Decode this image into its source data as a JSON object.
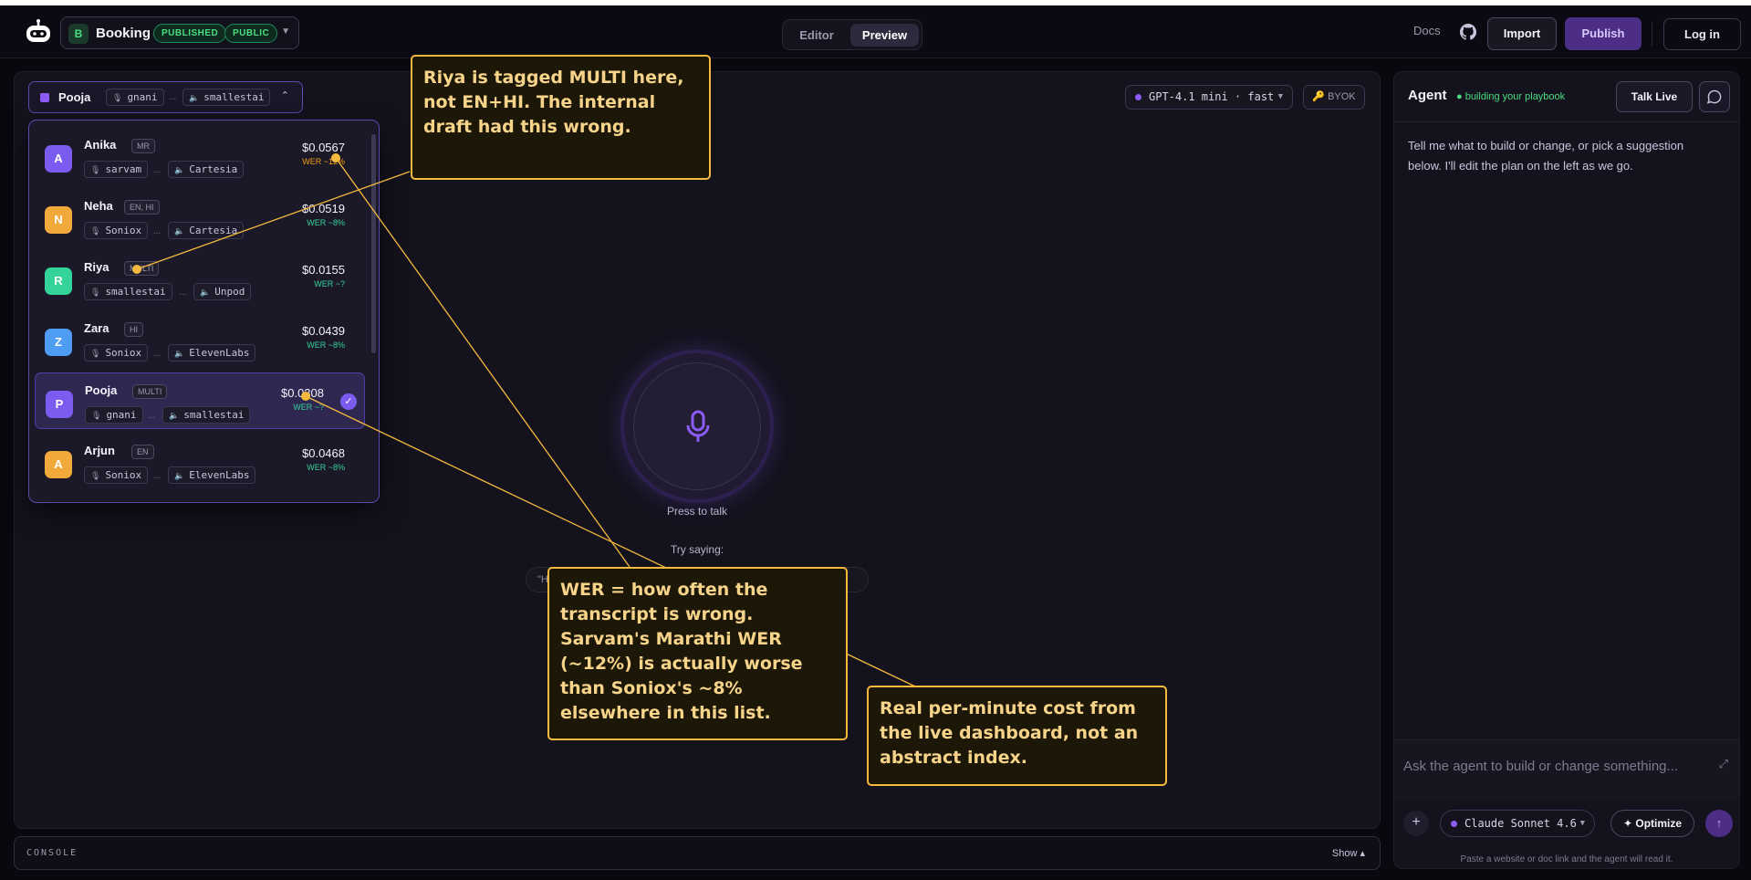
{
  "header": {
    "project_initial": "B",
    "project_name": "Booking",
    "badge_published": "PUBLISHED",
    "badge_public": "PUBLIC",
    "mode_tabs": [
      "Editor",
      "Preview"
    ],
    "active_tab": "Preview",
    "docs": "Docs",
    "import": "Import",
    "publish": "Publish",
    "login": "Log in"
  },
  "voice_selector": {
    "name": "Pooja",
    "stt": "gnani",
    "tts": "smallestai",
    "separator": "..."
  },
  "model_selector": {
    "label": "GPT-4.1 mini · fast"
  },
  "byok": "🔑 BYOK",
  "voices": [
    {
      "initial": "A",
      "name": "Anika",
      "lang": "MR",
      "stt": "sarvam",
      "tts": "Cartesia",
      "price": "$0.0567",
      "wer": "WER ~12%",
      "color": "#7c5cf0",
      "wer_warn": true
    },
    {
      "initial": "N",
      "name": "Neha",
      "lang": "EN, HI",
      "stt": "Soniox",
      "tts": "Cartesia",
      "price": "$0.0519",
      "wer": "WER ~8%",
      "color": "#f2a93b",
      "wer_warn": false
    },
    {
      "initial": "R",
      "name": "Riya",
      "lang": "MULTI",
      "stt": "smallestai",
      "tts": "Unpod",
      "price": "$0.0155",
      "wer": "WER ~?",
      "color": "#34d399",
      "wer_warn": false
    },
    {
      "initial": "Z",
      "name": "Zara",
      "lang": "HI",
      "stt": "Soniox",
      "tts": "ElevenLabs",
      "price": "$0.0439",
      "wer": "WER ~8%",
      "color": "#4f9cf5",
      "wer_warn": false
    },
    {
      "initial": "P",
      "name": "Pooja",
      "lang": "MULTI",
      "stt": "gnani",
      "tts": "smallestai",
      "price": "$0.0308",
      "wer": "WER ~?",
      "color": "#7c5cf0",
      "wer_warn": false,
      "selected": true
    },
    {
      "initial": "A",
      "name": "Arjun",
      "lang": "EN",
      "stt": "Soniox",
      "tts": "ElevenLabs",
      "price": "$0.0468",
      "wer": "WER ~8%",
      "color": "#f2a93b",
      "wer_warn": false
    }
  ],
  "center": {
    "press_to_talk": "Press to talk",
    "try_saying": "Try saying:",
    "suggestions": [
      "\"H",
      "...help me\""
    ]
  },
  "annotations": {
    "riya": "Riya is tagged MULTI here, not EN+HI. The internal draft had this wrong.",
    "wer": "WER = how often the transcript is wrong. Sarvam's Marathi WER (~12%) is actually worse than Soniox's ~8% elsewhere in this list.",
    "cost": "Real per-minute cost from the live dashboard, not an abstract index."
  },
  "console": {
    "label": "CONSOLE",
    "toggle": "Show ▴"
  },
  "agent_panel": {
    "title": "Agent",
    "status": "● building your playbook",
    "talk_live": "Talk Live",
    "message": "Tell me what to build or change, or pick a suggestion below. I'll edit the plan on the left as we go.",
    "input_placeholder": "Ask the agent to build or change something...",
    "model": "Claude Sonnet 4.6",
    "optimize": "✦ Optimize",
    "footer": "Paste a website or doc link and the agent will read it."
  },
  "colors": {
    "accent": "#7c5cf0",
    "success": "#4ade80",
    "annotation": "#f5b93e"
  }
}
